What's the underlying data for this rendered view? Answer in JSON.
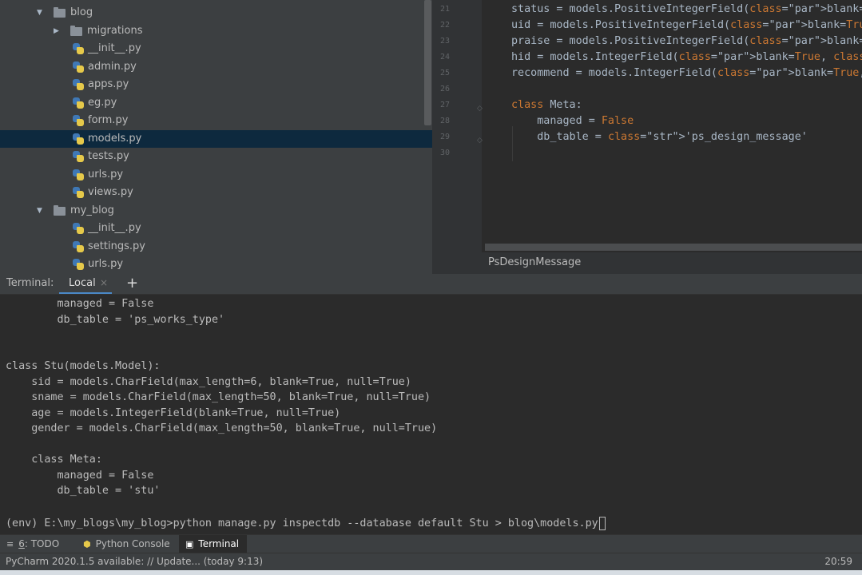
{
  "project_tree": [
    {
      "type": "folder",
      "label": "blog",
      "expanded": true,
      "depth": 1
    },
    {
      "type": "folder",
      "label": "migrations",
      "expanded": false,
      "depth": 2
    },
    {
      "type": "file",
      "label": "__init__.py",
      "depth": 2
    },
    {
      "type": "file",
      "label": "admin.py",
      "depth": 2
    },
    {
      "type": "file",
      "label": "apps.py",
      "depth": 2
    },
    {
      "type": "file",
      "label": "eg.py",
      "depth": 2
    },
    {
      "type": "file",
      "label": "form.py",
      "depth": 2
    },
    {
      "type": "file",
      "label": "models.py",
      "depth": 2,
      "selected": true
    },
    {
      "type": "file",
      "label": "tests.py",
      "depth": 2
    },
    {
      "type": "file",
      "label": "urls.py",
      "depth": 2
    },
    {
      "type": "file",
      "label": "views.py",
      "depth": 2
    },
    {
      "type": "folder",
      "label": "my_blog",
      "expanded": true,
      "depth": 1
    },
    {
      "type": "file",
      "label": "__init__.py",
      "depth": 2
    },
    {
      "type": "file",
      "label": "settings.py",
      "depth": 2
    },
    {
      "type": "file",
      "label": "urls.py",
      "depth": 2
    }
  ],
  "editor": {
    "line_numbers": [
      "21",
      "22",
      "23",
      "24",
      "25",
      "26",
      "27",
      "28",
      "29",
      "30"
    ],
    "lines": [
      "status = models.PositiveIntegerField(blank=True, null=True)",
      "uid = models.PositiveIntegerField(blank=True, null=True)",
      "praise = models.PositiveIntegerField(blank=True, null=True)",
      "hid = models.IntegerField(blank=True, null=True)",
      "recommend = models.IntegerField(blank=True, null=True)",
      "",
      "class Meta:",
      "    managed = False",
      "    db_table = 'ps_design_message'",
      ""
    ],
    "breadcrumb": "PsDesignMessage"
  },
  "terminal": {
    "title": "Terminal:",
    "tab_label": "Local",
    "close_glyph": "×",
    "add_glyph": "+",
    "lines": [
      "        managed = False",
      "        db_table = 'ps_works_type'",
      "",
      "",
      "class Stu(models.Model):",
      "    sid = models.CharField(max_length=6, blank=True, null=True)",
      "    sname = models.CharField(max_length=50, blank=True, null=True)",
      "    age = models.IntegerField(blank=True, null=True)",
      "    gender = models.CharField(max_length=50, blank=True, null=True)",
      "",
      "    class Meta:",
      "        managed = False",
      "        db_table = 'stu'",
      ""
    ],
    "prompt_line": "(env) E:\\my_blogs\\my_blog>python manage.py inspectdb --database default Stu > blog\\models.py"
  },
  "tool_tabs": {
    "todo": {
      "icon": "≡",
      "number": "6",
      "label": ": TODO"
    },
    "python_console": {
      "icon": "⬢",
      "label": "Python Console"
    },
    "terminal": {
      "icon": "▣",
      "label": "Terminal"
    }
  },
  "status": {
    "message": "PyCharm 2020.1.5 available: // Update... (today 9:13)",
    "time": "20:59"
  },
  "colors": {
    "panel": "#3c3f41",
    "editor_bg": "#2b2b2b",
    "keyword": "#cc7832",
    "string": "#6a8759",
    "param": "#aa4926",
    "selection": "#0d293e"
  }
}
